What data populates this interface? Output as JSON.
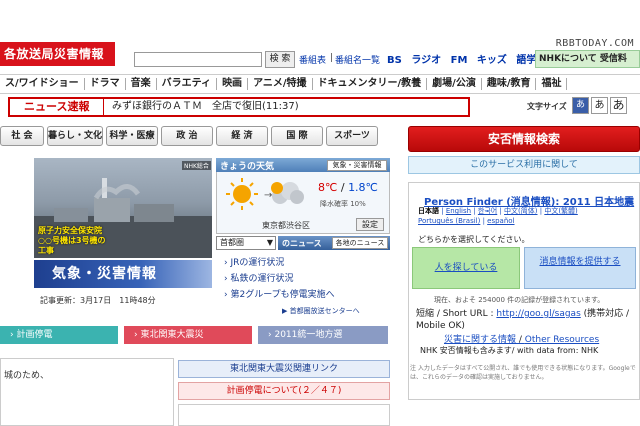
{
  "header": {
    "logo_text": "各放送局災害情報",
    "watermark": "RBBTODAY.COM",
    "search_button": "検 索",
    "links": [
      "番組表",
      "番組名一覧"
    ],
    "top_tabs": [
      "BS",
      "ラジオ",
      "FM",
      "キッズ",
      "語学"
    ],
    "nhk_about": "NHKについて 受信料"
  },
  "genre_nav": [
    "ス/ワイドショー",
    "ドラマ",
    "音楽",
    "バラエティ",
    "映画",
    "アニメ/特撮",
    "ドキュメンタリー/教養",
    "劇場/公演",
    "趣味/教育",
    "福祉"
  ],
  "news_bar": {
    "label": "ニュース速報",
    "text": "みずほ銀行のＡＴＭ　全店で復旧(11:37)"
  },
  "font_size": {
    "label": "文字サイズ",
    "options": [
      "あ",
      "あ",
      "あ"
    ]
  },
  "category_tabs": [
    "社 会",
    "暮らし・文化",
    "科学・医療",
    "政 治",
    "経 済",
    "国 際",
    "スポーツ"
  ],
  "main_news": {
    "photo_caption": "原子力安全保安院 ○○号機は3号機の工事",
    "photo_badge": "NHK総合",
    "banner": "気象・災害情報",
    "update_time": "記事更新：3月17日　11時48分"
  },
  "weather": {
    "title": "きょうの天気",
    "link": "気象・災害情報",
    "temp_high": "8℃",
    "temp_sep": " / ",
    "temp_low": "1.8℃",
    "rain": "降水確率 10%",
    "city": "東京都渋谷区",
    "set_button": "設定"
  },
  "regional": {
    "select_value": "首都圏",
    "label": "のニュース",
    "tab": "各地のニュース",
    "items": [
      "JRの運行状況",
      "私鉄の運行状況",
      "第2グループも停電実施へ"
    ],
    "more_link": "首都圏放送センターへ"
  },
  "color_bars": [
    {
      "label": "計画停電",
      "color": "#3bb3b0"
    },
    {
      "label": "東北関東大震災",
      "color": "#e04a5a"
    },
    {
      "label": "2011統一地方選",
      "color": "#8a9bc4"
    }
  ],
  "bottom": {
    "left_text": "城のため、",
    "quake_link": "東北関東大震災関連リンク",
    "plan_link": "計画停電について(２／４７)"
  },
  "safety": {
    "button": "安否情報検索",
    "about": "このサービス利用に関して"
  },
  "person_finder": {
    "title": "Person Finder (消息情報): 2011 日本地震",
    "lang_current": "日本語",
    "lang_row1": [
      "English",
      "한국어",
      "中文(简体)",
      "中文(繁體)"
    ],
    "lang_row2": [
      "Português (Brasil)",
      "español"
    ],
    "choose": "どちらかを選択してください。",
    "seek": "人を探している",
    "provide": "消息情報を提供する",
    "count": "現在、およそ 254000 件の記録が登録されています。",
    "short_prefix": "短縮 / Short URL : ",
    "short_url": "http://goo.gl/sagas",
    "short_suffix": " (携帯対応 / Mobile OK)",
    "link_about": "災害に関する情報",
    "link_sep": " / ",
    "link_other": "Other Resources",
    "nhk": "NHK 安否情報も含みます/ with data from: NHK",
    "note": "注 入力したデータはすべて公開され、誰でも使用できる状態になります。Googleでは、これらのデータの確認は実施しておりません。"
  }
}
